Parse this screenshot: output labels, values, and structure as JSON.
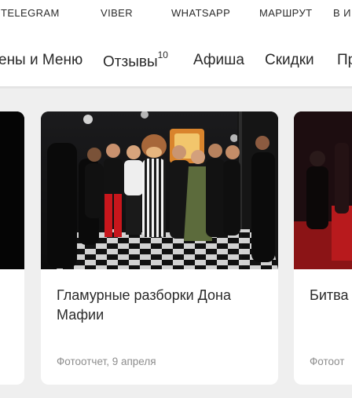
{
  "topbar": {
    "links": [
      "TELEGRAM",
      "VIBER",
      "WHATSAPP",
      "МАРШРУТ",
      "В И"
    ]
  },
  "nav": {
    "items": [
      {
        "label": "ены и Меню"
      },
      {
        "label": "Отзывы",
        "badge": "10"
      },
      {
        "label": "Афиша"
      },
      {
        "label": "Скидки"
      },
      {
        "label": "Пр"
      }
    ]
  },
  "cards": [
    {
      "title": "",
      "meta": ""
    },
    {
      "title": "Гламурные разборки Дона Мафии",
      "meta": "Фотоотчет, 9 апреля"
    },
    {
      "title": "Битва",
      "meta": "Фотоот"
    }
  ]
}
